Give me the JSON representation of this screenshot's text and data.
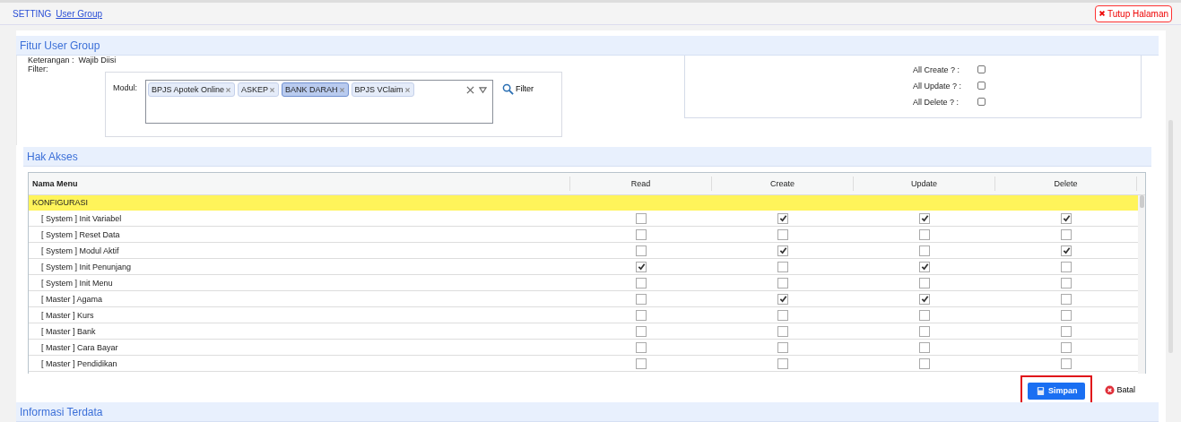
{
  "breadcrumb": [
    {
      "label": "SETTING",
      "kind": "text"
    },
    {
      "label": "User Group",
      "kind": "link"
    }
  ],
  "close_button": {
    "label": "Tutup Halaman"
  },
  "fitur": {
    "title": "Fitur User Group",
    "keterangan_label": "Keterangan :",
    "keterangan_value": "Wajib Diisi",
    "filter_label": "Filter:",
    "modul_label": "Modul:",
    "tags": [
      {
        "label": "BPJS Apotek Online",
        "selected": false
      },
      {
        "label": "ASKEP",
        "selected": false
      },
      {
        "label": "BANK DARAH",
        "selected": true
      },
      {
        "label": "BPJS VClaim",
        "selected": false
      }
    ],
    "filter_button": "Filter",
    "all_checks": [
      {
        "label": "All Create ? :",
        "checked": false
      },
      {
        "label": "All Update ? :",
        "checked": false
      },
      {
        "label": "All Delete ? :",
        "checked": false
      }
    ]
  },
  "hak_akses": {
    "title": "Hak Akses",
    "columns": [
      "Nama Menu",
      "Read",
      "Create",
      "Update",
      "Delete"
    ],
    "group": "KONFIGURASI",
    "rows": [
      {
        "name": "[ System ] Init Variabel",
        "checks": [
          false,
          true,
          true,
          true
        ]
      },
      {
        "name": "[ System ] Reset Data",
        "checks": [
          false,
          false,
          false,
          false
        ]
      },
      {
        "name": "[ System ] Modul Aktif",
        "checks": [
          false,
          true,
          false,
          true
        ]
      },
      {
        "name": "[ System ] Init Penunjang",
        "checks": [
          true,
          false,
          true,
          false
        ]
      },
      {
        "name": "[ System ] Init Menu",
        "checks": [
          false,
          false,
          false,
          false
        ]
      },
      {
        "name": "[ Master ] Agama",
        "checks": [
          false,
          true,
          true,
          false
        ]
      },
      {
        "name": "[ Master ] Kurs",
        "checks": [
          false,
          false,
          false,
          false
        ]
      },
      {
        "name": "[ Master ] Bank",
        "checks": [
          false,
          false,
          false,
          false
        ]
      },
      {
        "name": "[ Master ] Cara Bayar",
        "checks": [
          false,
          false,
          false,
          false
        ]
      },
      {
        "name": "[ Master ] Pendidikan",
        "checks": [
          false,
          false,
          false,
          false
        ]
      }
    ]
  },
  "actions": {
    "save": {
      "label": "Simpan",
      "highlighted": true
    },
    "cancel": {
      "label": "Batal"
    }
  },
  "info": {
    "title": "Informasi Terdata"
  }
}
